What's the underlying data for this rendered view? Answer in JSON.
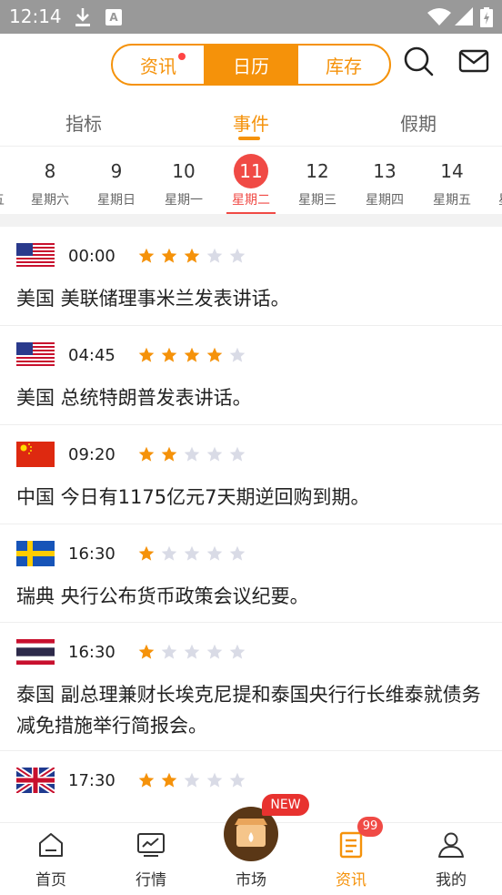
{
  "status_bar": {
    "time": "12:14",
    "a_label": "A"
  },
  "header": {
    "segments": [
      {
        "label": "资讯",
        "has_dot": true,
        "active": false
      },
      {
        "label": "日历",
        "has_dot": false,
        "active": true
      },
      {
        "label": "库存",
        "has_dot": false,
        "active": false
      }
    ],
    "icons": [
      "search-icon",
      "mail-icon"
    ]
  },
  "subtabs": [
    {
      "label": "指标",
      "active": false
    },
    {
      "label": "事件",
      "active": true
    },
    {
      "label": "假期",
      "active": false
    }
  ],
  "dates": [
    {
      "num": "",
      "week": "五"
    },
    {
      "num": "8",
      "week": "星期六"
    },
    {
      "num": "9",
      "week": "星期日"
    },
    {
      "num": "10",
      "week": "星期一"
    },
    {
      "num": "11",
      "week": "星期二",
      "selected": true
    },
    {
      "num": "12",
      "week": "星期三"
    },
    {
      "num": "13",
      "week": "星期四"
    },
    {
      "num": "14",
      "week": "星期五"
    },
    {
      "num": "",
      "week": "星"
    }
  ],
  "events": [
    {
      "flag": "us",
      "time": "00:00",
      "stars": 3,
      "text": "美国 美联储理事米兰发表讲话。"
    },
    {
      "flag": "us",
      "time": "04:45",
      "stars": 4,
      "text": "美国 总统特朗普发表讲话。"
    },
    {
      "flag": "cn",
      "time": "09:20",
      "stars": 2,
      "text": "中国 今日有1175亿元7天期逆回购到期。"
    },
    {
      "flag": "se",
      "time": "16:30",
      "stars": 1,
      "text": "瑞典 央行公布货币政策会议纪要。"
    },
    {
      "flag": "th",
      "time": "16:30",
      "stars": 1,
      "text": "泰国 副总理兼财长埃克尼提和泰国央行行长维泰就债务减免措施举行简报会。"
    },
    {
      "flag": "gb",
      "time": "17:30",
      "stars": 2,
      "text": ""
    }
  ],
  "bottom_nav": {
    "items": [
      {
        "label": "首页",
        "icon": "home-icon"
      },
      {
        "label": "行情",
        "icon": "chart-icon"
      },
      {
        "label": "市场",
        "icon": "market-icon"
      },
      {
        "label": "资讯",
        "icon": "news-icon",
        "active": true
      },
      {
        "label": "我的",
        "icon": "profile-icon"
      }
    ],
    "new_badge": "NEW",
    "news_count": "99"
  },
  "colors": {
    "accent": "#f5920a",
    "selected": "#f04a45",
    "star_on": "#f5920a",
    "star_off": "#d9dbe6"
  }
}
